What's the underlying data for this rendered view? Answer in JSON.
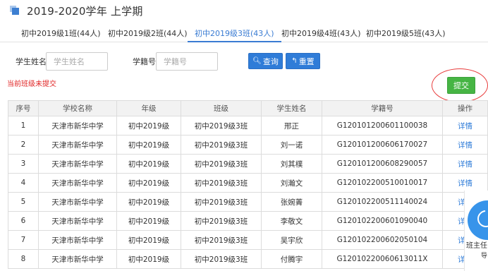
{
  "page": {
    "title": "2019-2020学年 上学期"
  },
  "tabs": [
    {
      "label": "初中2019级1班(44人)",
      "active": false
    },
    {
      "label": "初中2019级2班(44人)",
      "active": false
    },
    {
      "label": "初中2019级3班(43人)",
      "active": true
    },
    {
      "label": "初中2019级4班(43人)",
      "active": false
    },
    {
      "label": "初中2019级5班(43人)",
      "active": false
    }
  ],
  "search": {
    "name_label": "学生姓名",
    "name_placeholder": "学生姓名",
    "id_label": "学籍号",
    "id_placeholder": "学籍号",
    "query_label": "查询",
    "reset_label": "重置"
  },
  "status": {
    "warning": "当前班级未提交"
  },
  "actions": {
    "submit_label": "提交"
  },
  "table": {
    "headers": [
      "序号",
      "学校名称",
      "年级",
      "班级",
      "学生姓名",
      "学籍号",
      "操作"
    ],
    "rows": [
      [
        "1",
        "天津市新华中学",
        "初中2019级",
        "初中2019级3班",
        "邢正",
        "G120101200601100038",
        "详情"
      ],
      [
        "2",
        "天津市新华中学",
        "初中2019级",
        "初中2019级3班",
        "刘一诺",
        "G120101200606170027",
        "详情"
      ],
      [
        "3",
        "天津市新华中学",
        "初中2019级",
        "初中2019级3班",
        "刘其樸",
        "G120101200608290057",
        "详情"
      ],
      [
        "4",
        "天津市新华中学",
        "初中2019级",
        "初中2019级3班",
        "刘瀚文",
        "G120102200510010017",
        "详情"
      ],
      [
        "5",
        "天津市新华中学",
        "初中2019级",
        "初中2019级3班",
        "张婉菁",
        "G120102200511140024",
        "详情"
      ],
      [
        "6",
        "天津市新华中学",
        "初中2019级",
        "初中2019级3班",
        "李敬文",
        "G120102200601090040",
        "详情"
      ],
      [
        "7",
        "天津市新华中学",
        "初中2019级",
        "初中2019级3班",
        "吴宇欣",
        "G120102200602050104",
        "详情"
      ],
      [
        "8",
        "天津市新华中学",
        "初中2019级",
        "初中2019级3班",
        "付腾宇",
        "G12010220060613011X",
        "详情"
      ]
    ]
  },
  "widget": {
    "label": "班主任",
    "sub": "导"
  },
  "colors": {
    "accent": "#2f7cd8",
    "submit": "#46b544",
    "warning": "#e02424",
    "highlight_circle": "#e83b3b"
  }
}
